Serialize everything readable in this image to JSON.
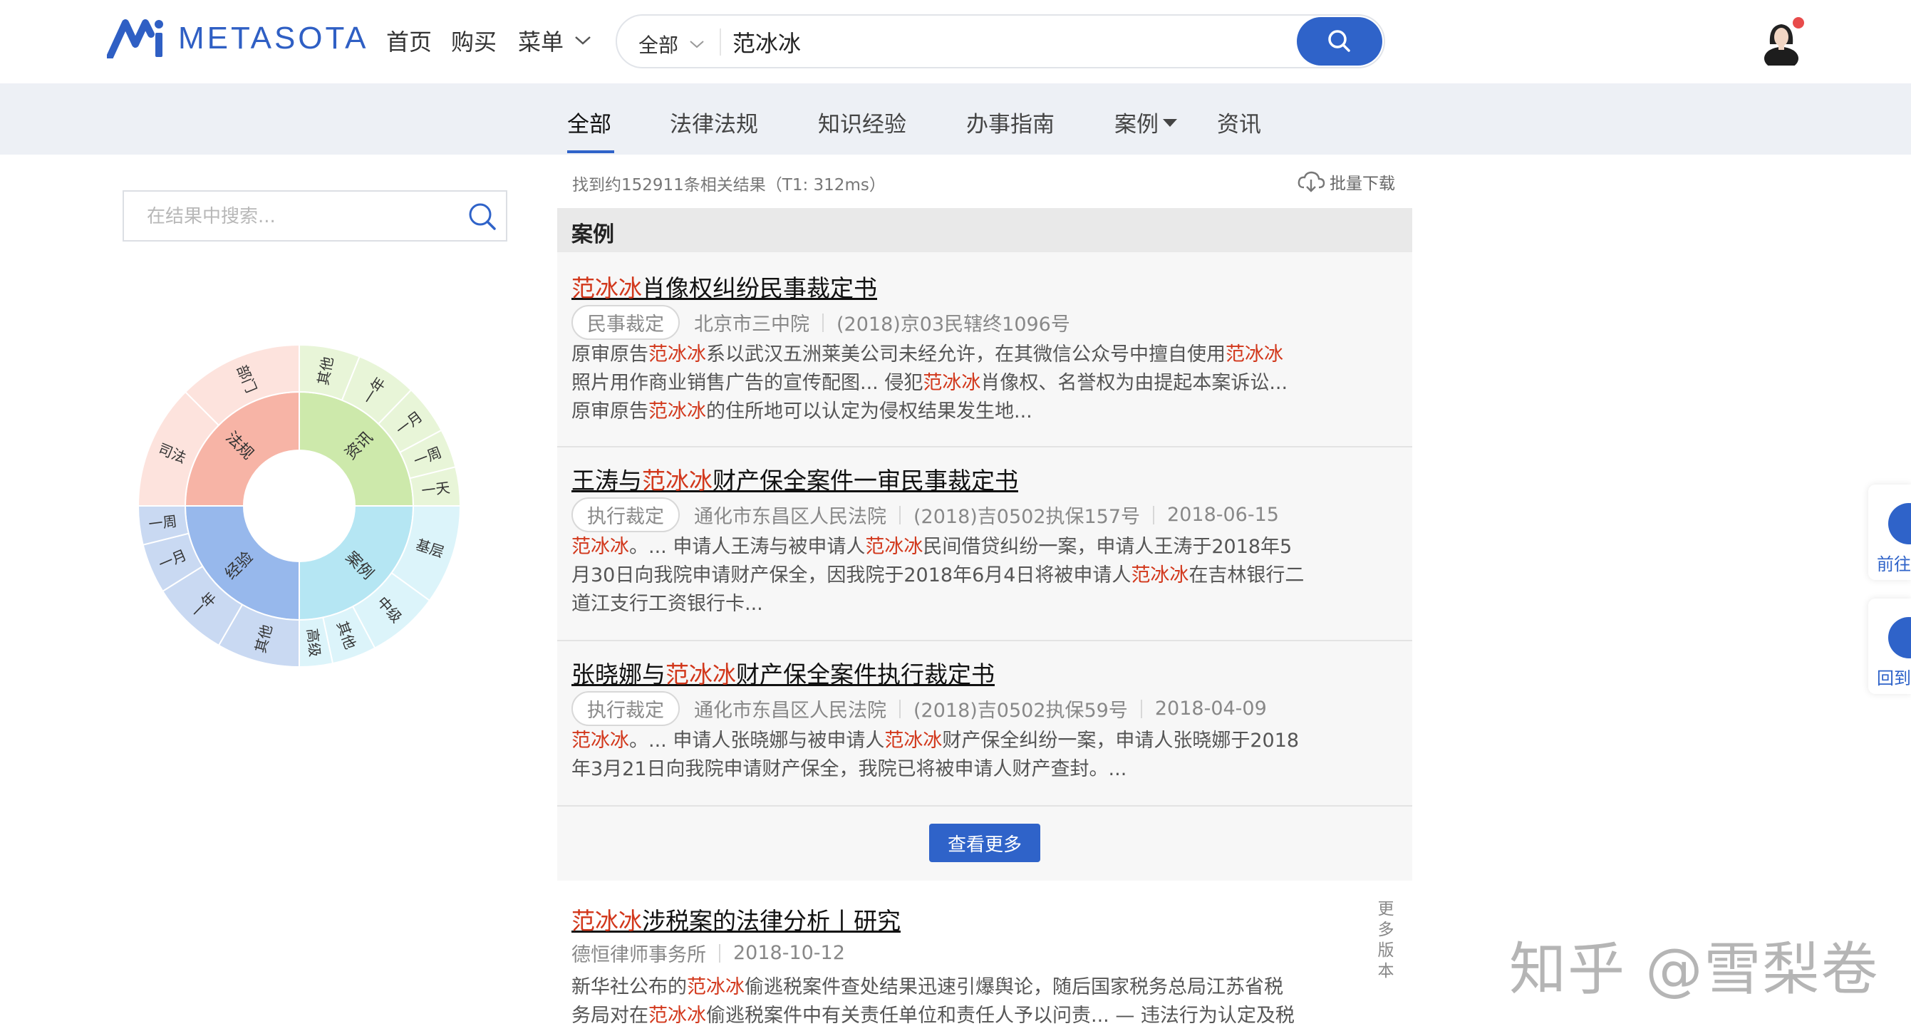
{
  "header": {
    "logo_text": "METASOTA",
    "nav": [
      "首页",
      "购买",
      "菜单"
    ],
    "search_scope": "全部",
    "search_value": "范冰冰"
  },
  "tabs": [
    {
      "label": "全部",
      "active": true
    },
    {
      "label": "法律法规",
      "active": false
    },
    {
      "label": "知识经验",
      "active": false
    },
    {
      "label": "办事指南",
      "active": false
    },
    {
      "label": "案例",
      "active": false,
      "dropdown": true
    },
    {
      "label": "资讯",
      "active": false
    }
  ],
  "sidebar": {
    "filter_placeholder": "在结果中搜索...",
    "sunburst": {
      "inner": [
        {
          "label": "法规",
          "color": "#f7b4a6"
        },
        {
          "label": "资讯",
          "color": "#cde9ab"
        },
        {
          "label": "案例",
          "color": "#b5e6f3"
        },
        {
          "label": "经验",
          "color": "#97b8ec"
        }
      ],
      "outer": [
        {
          "label": "部门",
          "parent": "法规",
          "color": "#fde3dd"
        },
        {
          "label": "司法",
          "parent": "法规",
          "color": "#fde3dd"
        },
        {
          "label": "其他",
          "parent": "资讯",
          "color": "#e8f5d8"
        },
        {
          "label": "一年",
          "parent": "资讯",
          "color": "#e8f5d8"
        },
        {
          "label": "一月",
          "parent": "资讯",
          "color": "#e8f5d8"
        },
        {
          "label": "一周",
          "parent": "资讯",
          "color": "#e8f5d8"
        },
        {
          "label": "一天",
          "parent": "资讯",
          "color": "#e8f5d8"
        },
        {
          "label": "基层",
          "parent": "案例",
          "color": "#dcf4fa"
        },
        {
          "label": "中级",
          "parent": "案例",
          "color": "#dcf4fa"
        },
        {
          "label": "其他",
          "parent": "案例",
          "color": "#dcf4fa"
        },
        {
          "label": "高级",
          "parent": "案例",
          "color": "#dcf4fa"
        },
        {
          "label": "其他",
          "parent": "经验",
          "color": "#c9d9f2"
        },
        {
          "label": "一年",
          "parent": "经验",
          "color": "#c9d9f2"
        },
        {
          "label": "一月",
          "parent": "经验",
          "color": "#c9d9f2"
        },
        {
          "label": "一周",
          "parent": "经验",
          "color": "#c9d9f2"
        }
      ]
    }
  },
  "results": {
    "count_text": "找到约152911条相关结果（T1: 312ms）",
    "bulk_download": "批量下载",
    "section_title": "案例",
    "cases": [
      {
        "title_parts": [
          {
            "t": "范冰冰",
            "hl": true
          },
          {
            "t": "肖像权纠纷民事裁定书",
            "hl": false
          }
        ],
        "tag": "民事裁定",
        "meta": [
          "北京市三中院",
          "(2018)京03民辖终1096号"
        ],
        "snippet_lines": [
          [
            {
              "t": "原审原告",
              "hl": false
            },
            {
              "t": "范冰冰",
              "hl": true
            },
            {
              "t": "系以武汉五洲莱美公司未经允许，在其微信公众号中擅自使用",
              "hl": false
            },
            {
              "t": "范冰冰",
              "hl": true
            }
          ],
          [
            {
              "t": "照片用作商业销售广告的宣传配图... 侵犯",
              "hl": false
            },
            {
              "t": "范冰冰",
              "hl": true
            },
            {
              "t": "肖像权、名誉权为由提起本案诉讼...",
              "hl": false
            }
          ],
          [
            {
              "t": "原审原告",
              "hl": false
            },
            {
              "t": "范冰冰",
              "hl": true
            },
            {
              "t": "的住所地可以认定为侵权结果发生地...",
              "hl": false
            }
          ]
        ]
      },
      {
        "title_parts": [
          {
            "t": "王涛与",
            "hl": false
          },
          {
            "t": "范冰冰",
            "hl": true
          },
          {
            "t": "财产保全案件一审民事裁定书",
            "hl": false
          }
        ],
        "tag": "执行裁定",
        "meta": [
          "通化市东昌区人民法院",
          "(2018)吉0502执保157号",
          "2018-06-15"
        ],
        "snippet_lines": [
          [
            {
              "t": "范冰冰",
              "hl": true
            },
            {
              "t": "。... 申请人王涛与被申请人",
              "hl": false
            },
            {
              "t": "范冰冰",
              "hl": true
            },
            {
              "t": "民间借贷纠纷一案，申请人王涛于2018年5",
              "hl": false
            }
          ],
          [
            {
              "t": "月30日向我院申请财产保全，因我院于2018年6月4日将被申请人",
              "hl": false
            },
            {
              "t": "范冰冰",
              "hl": true
            },
            {
              "t": "在吉林银行二",
              "hl": false
            }
          ],
          [
            {
              "t": "道江支行工资银行卡...",
              "hl": false
            }
          ]
        ]
      },
      {
        "title_parts": [
          {
            "t": "张晓娜与",
            "hl": false
          },
          {
            "t": "范冰冰",
            "hl": true
          },
          {
            "t": "财产保全案件执行裁定书",
            "hl": false
          }
        ],
        "tag": "执行裁定",
        "meta": [
          "通化市东昌区人民法院",
          "(2018)吉0502执保59号",
          "2018-04-09"
        ],
        "snippet_lines": [
          [
            {
              "t": "范冰冰",
              "hl": true
            },
            {
              "t": "。... 申请人张晓娜与被申请人",
              "hl": false
            },
            {
              "t": "范冰冰",
              "hl": true
            },
            {
              "t": "财产保全纠纷一案，申请人张晓娜于2018",
              "hl": false
            }
          ],
          [
            {
              "t": "年3月21日向我院申请财产保全，我院已将被申请人财产查封。...",
              "hl": false
            }
          ]
        ]
      }
    ],
    "more_button": "查看更多",
    "article": {
      "title_parts": [
        {
          "t": "范冰冰",
          "hl": true
        },
        {
          "t": "涉税案的法律分析丨研究",
          "hl": false
        }
      ],
      "meta": [
        "德恒律师事务所",
        "2018-10-12"
      ],
      "snippet_lines": [
        [
          {
            "t": "新华社公布的",
            "hl": false
          },
          {
            "t": "范冰冰",
            "hl": true
          },
          {
            "t": "偷逃税案件查处结果迅速引爆舆论，随后国家税务总局江苏省税",
            "hl": false
          }
        ],
        [
          {
            "t": "务局对在",
            "hl": false
          },
          {
            "t": "范冰冰",
            "hl": true
          },
          {
            "t": "偷逃税案件中有关责任单位和责任人予以问责... — 违法行为认定及税",
            "hl": false
          }
        ]
      ],
      "more_versions": "更多版本"
    }
  },
  "float_buttons": [
    "前往",
    "回到"
  ],
  "watermark": "知乎 @雪梨卷"
}
